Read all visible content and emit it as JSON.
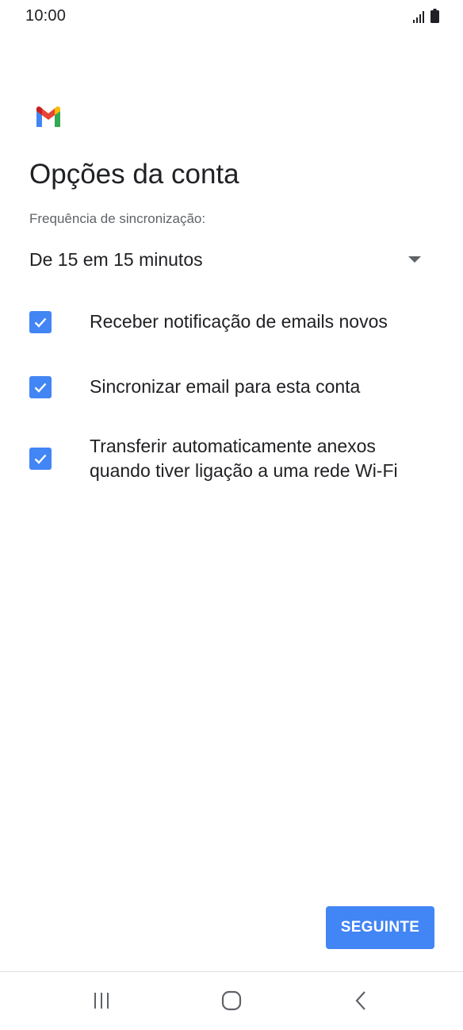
{
  "status_bar": {
    "time": "10:00"
  },
  "page": {
    "title": "Opções da conta",
    "sync_label": "Frequência de sincronização:",
    "sync_value": "De 15 em 15 minutos"
  },
  "options": [
    {
      "label": "Receber notificação de emails novos",
      "checked": true
    },
    {
      "label": "Sincronizar email para esta conta",
      "checked": true
    },
    {
      "label": "Transferir automaticamente anexos quando tiver ligação a uma rede Wi-Fi",
      "checked": true
    }
  ],
  "footer": {
    "next_label": "SEGUINTE"
  },
  "colors": {
    "accent": "#4285f4",
    "text": "#202124",
    "secondary_text": "#5f6368"
  },
  "icons": {
    "logo": "gmail-logo-icon",
    "signal": "signal-icon",
    "battery": "battery-icon",
    "dropdown": "dropdown-arrow-icon",
    "check": "check-icon",
    "recents": "recents-icon",
    "home": "home-icon",
    "back": "back-icon"
  }
}
